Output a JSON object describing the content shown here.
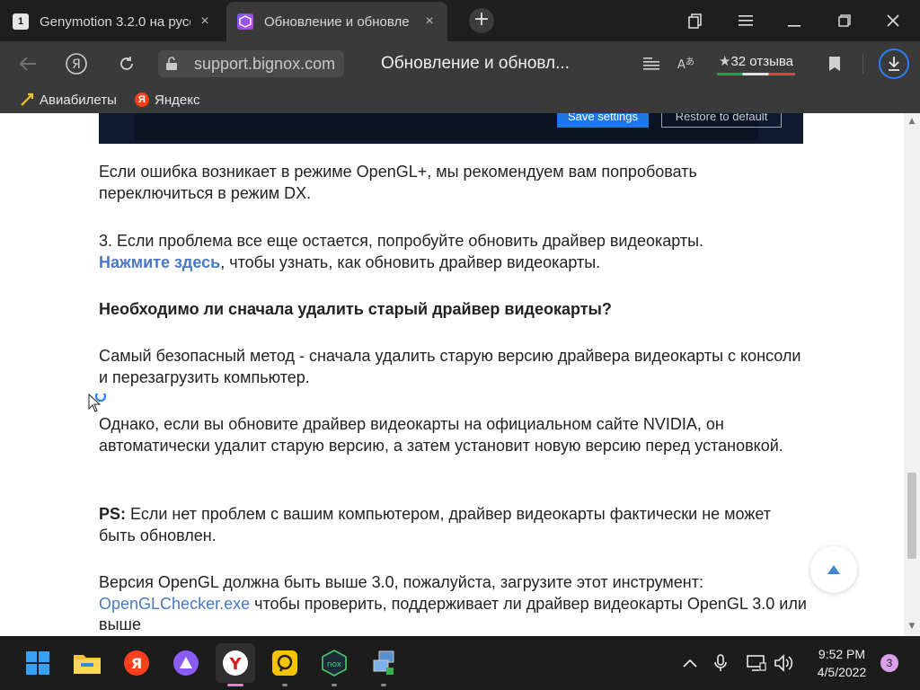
{
  "tabs": [
    {
      "title": "Genymotion 3.2.0 на русск",
      "favicon": "1"
    },
    {
      "title": "Обновление и обновле",
      "favicon": "nox"
    }
  ],
  "address": {
    "url": "support.bignox.com",
    "page_title": "Обновление и обновл...",
    "reviews": "32 отзыва"
  },
  "bookmarks": [
    {
      "label": "Авиабилеты"
    },
    {
      "label": "Яндекс"
    }
  ],
  "content": {
    "image_buttons": {
      "save": "Save settings",
      "restore": "Restore to default"
    },
    "p1": "Если ошибка возникает в режиме OpenGL+, мы рекомендуем вам попробовать переключиться в режим DX.",
    "p2_text": "3. Если проблема все еще остается, попробуйте обновить драйвер видеокарты.",
    "p2_link": "Нажмите здесь",
    "p2_after": ", чтобы узнать, как обновить драйвер видеокарты.",
    "heading": "Необходимо ли сначала удалить старый драйвер видеокарты?",
    "p3": "Самый безопасный метод - сначала удалить старую версию драйвера видеокарты с консоли и перезагрузить компьютер.",
    "p4": "Однако, если вы обновите драйвер видеокарты на официальном сайте NVIDIA, он автоматически удалит старую версию, а затем установит новую версию перед установкой.",
    "p5_bold": "PS:",
    "p5_text": " Если нет проблем с вашим компьютером, драйвер видеокарты фактически не может быть обновлен.",
    "p6_text": "Версия OpenGL должна быть выше 3.0, пожалуйста, загрузите этот инструмент:",
    "p6_link": "OpenGLChecker.exe",
    "p6_after": " чтобы проверить, поддерживает ли драйвер видеокарты OpenGL 3.0 или выше"
  },
  "taskbar": {
    "time": "9:52 PM",
    "date": "4/5/2022",
    "notification_count": "3"
  },
  "colors": {
    "link": "#4a79c4",
    "accent": "#2a7fff"
  }
}
